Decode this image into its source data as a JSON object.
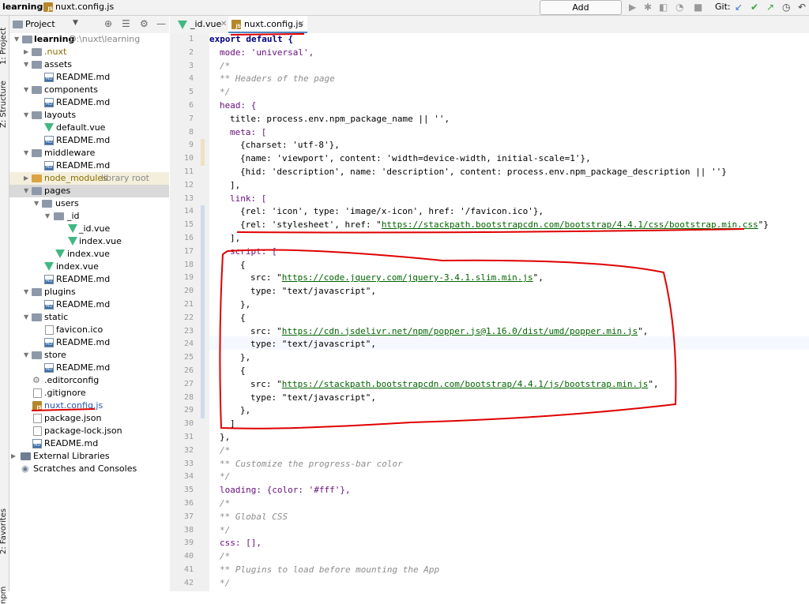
{
  "breadcrumb": {
    "project": "learning",
    "file": "nuxt.config.js"
  },
  "toolbar": {
    "add_configuration": "Add Configuration...",
    "git_label": "Git:"
  },
  "side_tabs": {
    "project": "1: Project",
    "structure": "Z: Structure",
    "favorites": "2: Favorites",
    "npm": "npm"
  },
  "project_panel": {
    "title": "Project"
  },
  "tree": {
    "root": {
      "name": "learning",
      "path": "D:\\nuxt\\learning"
    },
    "nuxt": ".nuxt",
    "assets": "assets",
    "assets_readme": "README.md",
    "components": "components",
    "components_readme": "README.md",
    "layouts": "layouts",
    "layouts_default": "default.vue",
    "layouts_readme": "README.md",
    "middleware": "middleware",
    "middleware_readme": "README.md",
    "node_modules": "node_modules",
    "node_modules_hint": "library root",
    "pages": "pages",
    "users": "users",
    "id_folder": "_id",
    "id_vue": "_id.vue",
    "id_index": "index.vue",
    "users_index": "index.vue",
    "pages_index": "index.vue",
    "pages_readme": "README.md",
    "plugins": "plugins",
    "plugins_readme": "README.md",
    "static": "static",
    "favicon": "favicon.ico",
    "static_readme": "README.md",
    "store": "store",
    "store_readme": "README.md",
    "editorconfig": ".editorconfig",
    "gitignore": ".gitignore",
    "nuxt_config": "nuxt.config.js",
    "package_json": "package.json",
    "package_lock": "package-lock.json",
    "root_readme": "README.md",
    "external_libraries": "External Libraries",
    "scratches": "Scratches and Consoles"
  },
  "editor_tabs": {
    "tab1": "_id.vue",
    "tab2": "nuxt.config.js"
  },
  "code": {
    "line_numbers": [
      "1",
      "2",
      "3",
      "4",
      "5",
      "6",
      "7",
      "8",
      "9",
      "10",
      "11",
      "12",
      "13",
      "14",
      "15",
      "16",
      "17",
      "18",
      "19",
      "20",
      "21",
      "22",
      "23",
      "24",
      "25",
      "26",
      "27",
      "28",
      "29",
      "30",
      "31",
      "32",
      "33",
      "34",
      "35",
      "36",
      "37",
      "38",
      "39",
      "40",
      "41",
      "42"
    ],
    "l1": "export default {",
    "l2": "mode: 'universal',",
    "l3": "/*",
    "l4": "** Headers of the page",
    "l5": "*/",
    "l6": "head: {",
    "l7": "title: process.env.npm_package_name || '',",
    "l8": "meta: [",
    "l9": "{charset: 'utf-8'},",
    "l10": "{name: 'viewport', content: 'width=device-width, initial-scale=1'},",
    "l11": "{hid: 'description', name: 'description', content: process.env.npm_package_description || ''}",
    "l12": "],",
    "l13": "link: [",
    "l14": "{rel: 'icon', type: 'image/x-icon', href: '/favicon.ico'},",
    "l15_pre": "{rel: 'stylesheet', href: \"",
    "l15_url": "https://stackpath.bootstrapcdn.com/bootstrap/4.4.1/css/bootstrap.min.css",
    "l15_post": "\"}",
    "l16": "],",
    "l17": "script: [",
    "l18": "{",
    "l19_pre": "src: \"",
    "l19_url": "https://code.jquery.com/jquery-3.4.1.slim.min.js",
    "l19_post": "\",",
    "l20": "type: \"text/javascript\",",
    "l21": "},",
    "l22": "{",
    "l23_pre": "src: \"",
    "l23_url": "https://cdn.jsdelivr.net/npm/popper.js@1.16.0/dist/umd/popper.min.js",
    "l23_post": "\",",
    "l24": "type: \"text/javascript\",",
    "l25": "},",
    "l26": "{",
    "l27_pre": "src: \"",
    "l27_url": "https://stackpath.bootstrapcdn.com/bootstrap/4.4.1/js/bootstrap.min.js",
    "l27_post": "\",",
    "l28": "type: \"text/javascript\",",
    "l29": "},",
    "l30": "]",
    "l31": "},",
    "l32": "/*",
    "l33": "** Customize the progress-bar color",
    "l34": "*/",
    "l35": "loading: {color: '#fff'},",
    "l36": "/*",
    "l37": "** Global CSS",
    "l38": "*/",
    "l39": "css: [],",
    "l40": "/*",
    "l41": "** Plugins to load before mounting the App",
    "l42": "*/"
  }
}
